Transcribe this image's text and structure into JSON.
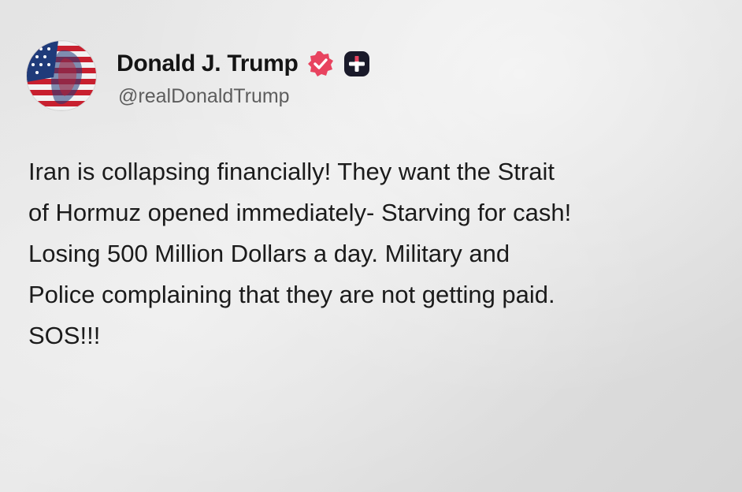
{
  "profile": {
    "display_name": "Donald J. Trump",
    "handle": "@realDonaldTrump",
    "avatar_icon": "avatar-flag-portrait",
    "verified_icon": "verified-badge-icon",
    "plus_icon": "plus-icon"
  },
  "post": {
    "lines": [
      "Iran is collapsing financially! They want the Strait",
      "of Hormuz opened immediately- Starving for cash!",
      "Losing 500 Million Dollars a day. Military and",
      "Police complaining that they are not getting paid.",
      "SOS!!!"
    ]
  },
  "colors": {
    "badge": "#e8435f",
    "plus_box": "#1a1a2a",
    "name": "#141414",
    "handle": "#5d5d5d",
    "text": "#1b1b1b"
  }
}
